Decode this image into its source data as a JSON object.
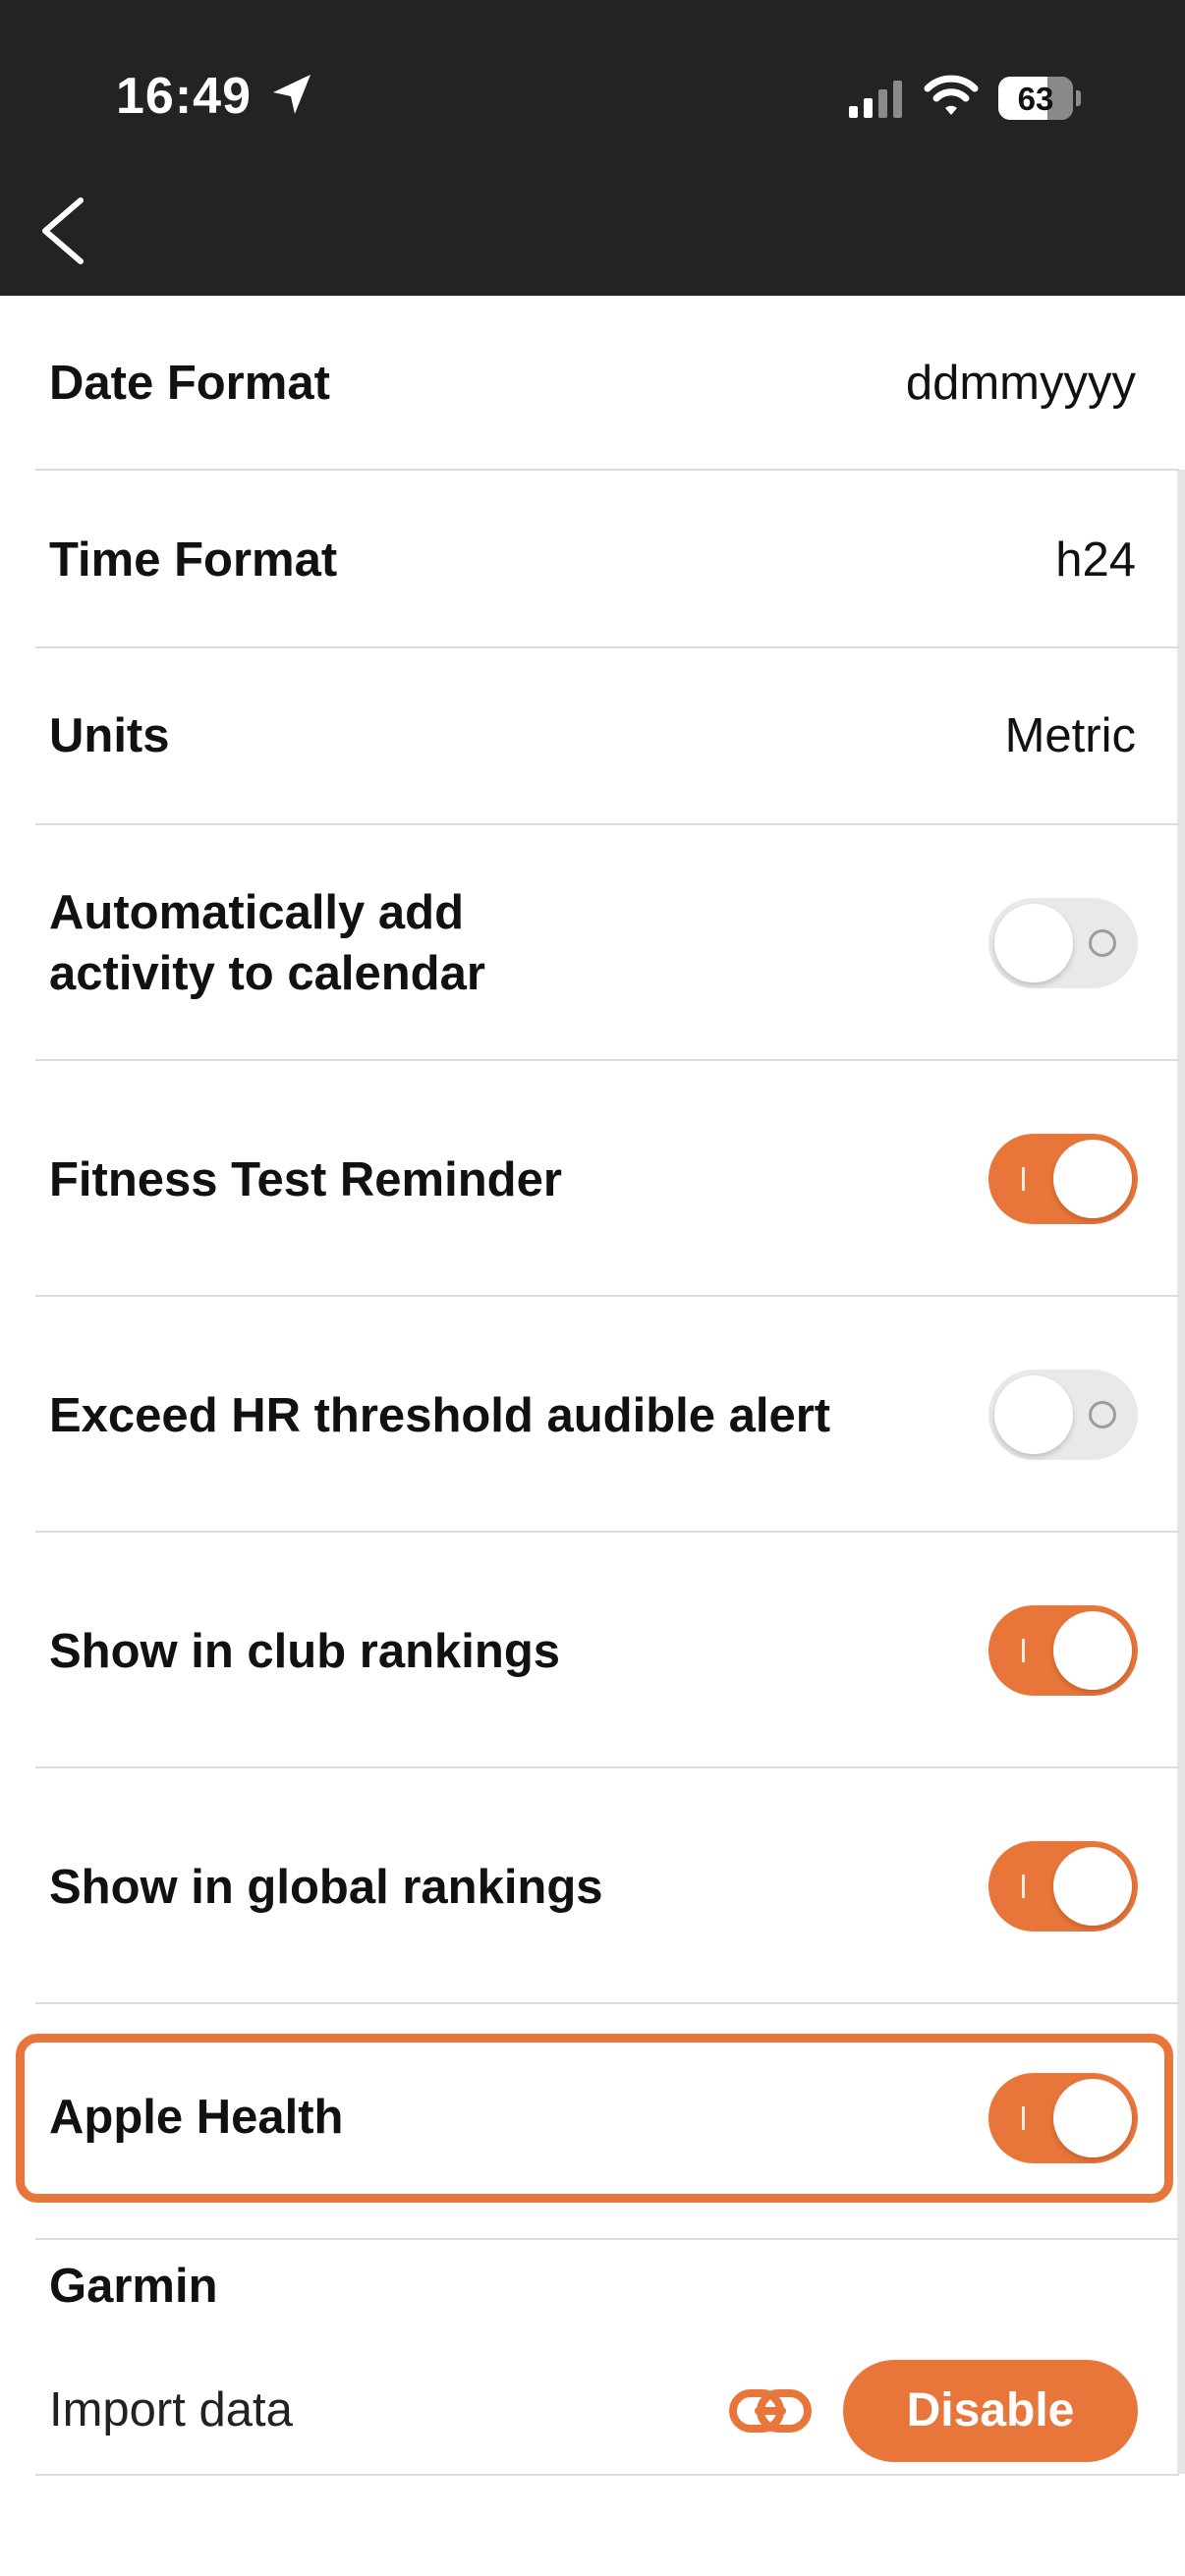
{
  "status_bar": {
    "time": "16:49",
    "battery_level": "63"
  },
  "colors": {
    "accent": "#e8763a",
    "header_bg": "#232323",
    "toggle_off": "#e9e9ea"
  },
  "settings": {
    "date_format": {
      "label": "Date Format",
      "value": "ddmmyyyy"
    },
    "time_format": {
      "label": "Time Format",
      "value": "h24"
    },
    "units": {
      "label": "Units",
      "value": "Metric"
    },
    "auto_calendar": {
      "label_line1": "Automatically add",
      "label_line2": "activity to calendar",
      "enabled": false
    },
    "fitness_test_reminder": {
      "label": "Fitness Test Reminder",
      "enabled": true
    },
    "hr_alert": {
      "label": "Exceed HR threshold audible alert",
      "enabled": false
    },
    "club_rankings": {
      "label": "Show in club rankings",
      "enabled": true
    },
    "global_rankings": {
      "label": "Show in global rankings",
      "enabled": true
    },
    "apple_health": {
      "label": "Apple Health",
      "enabled": true
    }
  },
  "garmin": {
    "title": "Garmin",
    "import_label": "Import data",
    "link_icon": "link-icon",
    "disable_label": "Disable"
  }
}
